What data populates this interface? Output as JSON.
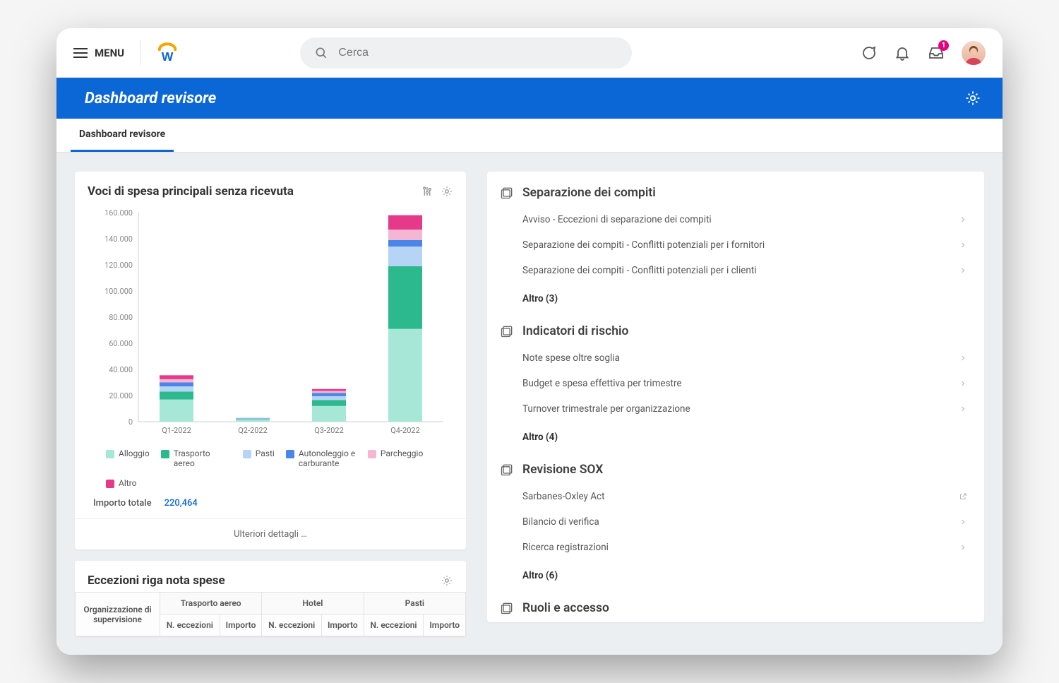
{
  "menu_label": "MENU",
  "search": {
    "placeholder": "Cerca"
  },
  "inbox_badge": "1",
  "page_title": "Dashboard revisore",
  "tab_label": "Dashboard revisore",
  "card1": {
    "title": "Voci di spesa principali senza ricevuta",
    "total_label": "Importo totale",
    "total_value": "220,464",
    "footer": "Ulteriori dettagli …"
  },
  "chart_data": {
    "type": "bar",
    "categories": [
      "Q1-2022",
      "Q2-2022",
      "Q3-2022",
      "Q4-2022"
    ],
    "series": [
      {
        "name": "Alloggio",
        "color": "#a7e7d7",
        "values": [
          17000,
          1500,
          12000,
          71000
        ]
      },
      {
        "name": "Trasporto aereo",
        "color": "#2cb98e",
        "values": [
          6000,
          500,
          4500,
          48000
        ]
      },
      {
        "name": "Pasti",
        "color": "#b6d4f5",
        "values": [
          4000,
          500,
          3000,
          15000
        ]
      },
      {
        "name": "Autonoleggio e carburante",
        "color": "#4a86e8",
        "values": [
          3000,
          300,
          2500,
          5000
        ]
      },
      {
        "name": "Parcheggio",
        "color": "#f4b6d2",
        "values": [
          2500,
          200,
          1500,
          8000
        ]
      },
      {
        "name": "Altro",
        "color": "#e6398a",
        "values": [
          3000,
          0,
          1500,
          11000
        ]
      }
    ],
    "ylabel": "",
    "xlabel": "",
    "ylim": [
      0,
      160000
    ],
    "ytick": 20000
  },
  "card2": {
    "title": "Eccezioni riga nota spese",
    "groups": [
      "Trasporto aereo",
      "Hotel",
      "Pasti"
    ],
    "row1col0": "Organizzazione di supervisione",
    "sub": [
      "N. eccezioni",
      "Importo"
    ]
  },
  "sections": [
    {
      "title": "Separazione dei compiti",
      "items": [
        {
          "label": "Avviso - Eccezioni di separazione dei compiti",
          "href": true
        },
        {
          "label": "Separazione dei compiti - Conflitti potenziali per i fornitori",
          "href": true
        },
        {
          "label": "Separazione dei compiti - Conflitti potenziali per i clienti",
          "href": true
        }
      ],
      "more": "Altro (3)"
    },
    {
      "title": "Indicatori di rischio",
      "items": [
        {
          "label": "Note spese oltre soglia",
          "href": true
        },
        {
          "label": "Budget e spesa effettiva per trimestre",
          "href": true
        },
        {
          "label": "Turnover trimestrale per organizzazione",
          "href": true
        }
      ],
      "more": "Altro (4)"
    },
    {
      "title": "Revisione SOX",
      "items": [
        {
          "label": "Sarbanes-Oxley Act",
          "ext": true
        },
        {
          "label": "Bilancio di verifica",
          "href": true
        },
        {
          "label": "Ricerca registrazioni",
          "href": true
        }
      ],
      "more": "Altro (6)"
    },
    {
      "title": "Ruoli e accesso",
      "items": [],
      "more": ""
    }
  ]
}
